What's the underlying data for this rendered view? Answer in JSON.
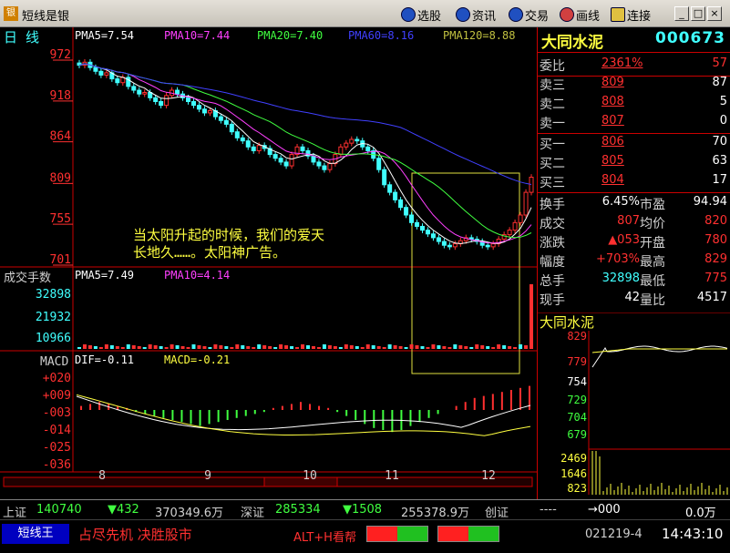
{
  "app": {
    "title": "短线是银",
    "menu": [
      "选股",
      "资讯",
      "交易",
      "画线",
      "连接"
    ]
  },
  "window_controls": [
    "_",
    "□",
    "×"
  ],
  "colors": {
    "up": "#ff3030",
    "down": "#40ffff",
    "pma5": "#ffffff",
    "pma10": "#ff40ff",
    "pma20": "#40ff40",
    "pma60": "#4040ff",
    "pma120": "#c0c040"
  },
  "kline": {
    "period_label": "日 线",
    "ma_labels": [
      {
        "text": "PMA5=7.54",
        "color": "#ffffff"
      },
      {
        "text": "PMA10=7.44",
        "color": "#ff40ff"
      },
      {
        "text": "PMA20=7.40",
        "color": "#40ff40"
      },
      {
        "text": "PMA60=8.16",
        "color": "#4040ff"
      },
      {
        "text": "PMA120=8.88",
        "color": "#c0c040"
      }
    ],
    "y_ticks": [
      "972",
      "918",
      "864",
      "809",
      "755",
      "701"
    ],
    "annotation_line1": "当太阳升起的时候，我们的爱天",
    "annotation_line2": "长地久……。太阳神广告。",
    "x_ticks": [
      "8",
      "9",
      "10",
      "11",
      "12"
    ]
  },
  "volume": {
    "title": "成交手数",
    "ma_labels": [
      {
        "text": "PMA5=7.49",
        "color": "#ffffff"
      },
      {
        "text": "PMA10=4.14",
        "color": "#ff40ff"
      }
    ],
    "y_ticks": [
      "32898",
      "21932",
      "10966"
    ]
  },
  "macd": {
    "title": "MACD",
    "labels": [
      {
        "text": "DIF=-0.11",
        "color": "#ffffff"
      },
      {
        "text": "MACD=-0.21",
        "color": "#ffff40"
      }
    ],
    "y_ticks": [
      "+020",
      "+009",
      "-003",
      "-014",
      "-025",
      "-036"
    ]
  },
  "quote": {
    "name": "大同水泥",
    "code": "000673",
    "rows": [
      {
        "label": "委比",
        "val": "2361%",
        "val_color": "#ff3030",
        "extra": "57",
        "extra_color": "#ff3030"
      },
      {
        "label": "卖三",
        "val": "809",
        "val_color": "#ff3030",
        "extra": "87",
        "extra_color": "#ffffff"
      },
      {
        "label": "卖二",
        "val": "808",
        "val_color": "#ff3030",
        "extra": "5",
        "extra_color": "#ffffff"
      },
      {
        "label": "卖一",
        "val": "807",
        "val_color": "#ff3030",
        "extra": "0",
        "extra_color": "#ffffff"
      },
      {
        "label": "买一",
        "val": "806",
        "val_color": "#ff3030",
        "extra": "70",
        "extra_color": "#ffffff"
      },
      {
        "label": "买二",
        "val": "805",
        "val_color": "#ff3030",
        "extra": "63",
        "extra_color": "#ffffff"
      },
      {
        "label": "买三",
        "val": "804",
        "val_color": "#ff3030",
        "extra": "17",
        "extra_color": "#ffffff"
      }
    ],
    "stats": [
      {
        "l1": "换手",
        "v1": "6.45%",
        "l2": "市盈",
        "v2": "94.94",
        "c1": "#ffffff",
        "c2": "#ffffff"
      },
      {
        "l1": "成交",
        "v1": "807",
        "l2": "均价",
        "v2": "820",
        "c1": "#ff3030",
        "c2": "#ff3030"
      },
      {
        "l1": "涨跌",
        "v1": "▲053",
        "l2": "开盘",
        "v2": "780",
        "c1": "#ff3030",
        "c2": "#ff3030"
      },
      {
        "l1": "幅度",
        "v1": "+703%",
        "l2": "最高",
        "v2": "829",
        "c1": "#ff3030",
        "c2": "#ff3030"
      },
      {
        "l1": "总手",
        "v1": "32898",
        "l2": "最低",
        "v2": "775",
        "c1": "#40ffff",
        "c2": "#ff3030"
      },
      {
        "l1": "现手",
        "v1": "42",
        "l2": "量比",
        "v2": "4517",
        "c1": "#ffffff",
        "c2": "#ffffff"
      }
    ]
  },
  "intraday": {
    "title": "大同水泥",
    "price_ticks": [
      "829",
      "779",
      "754",
      "729",
      "704",
      "679"
    ],
    "vol_ticks": [
      "2469",
      "1646",
      "823"
    ]
  },
  "status": {
    "sh_label": "上证",
    "sh_val": "140740",
    "sh_chg": "▼432",
    "sh_amt": "370349.6万",
    "sz_label": "深证",
    "sz_val": "285334",
    "sz_chg": "▼1508",
    "sz_amt": "255378.9万",
    "cy_label": "创证",
    "cy_dash": "----",
    "cy_arrow": "→000",
    "cy_amt": "0.0万"
  },
  "bottom": {
    "left_btn": "短线王",
    "slogan": "占尽先机 决胜股市",
    "hotkey": "ALT+H看帮",
    "date": "021219-4",
    "time": "14:43:10"
  },
  "chart_data": {
    "type": "candlestick",
    "title": "日线",
    "ylim": [
      701,
      972
    ],
    "x_tick_labels": [
      "8",
      "9",
      "10",
      "11",
      "12"
    ],
    "ma_values": {
      "PMA5": 7.54,
      "PMA10": 7.44,
      "PMA20": 7.4,
      "PMA60": 8.16,
      "PMA120": 8.88
    },
    "closes": [
      958,
      962,
      955,
      950,
      945,
      948,
      940,
      935,
      942,
      930,
      925,
      920,
      922,
      915,
      910,
      905,
      918,
      925,
      920,
      915,
      910,
      905,
      900,
      895,
      898,
      890,
      885,
      880,
      870,
      862,
      858,
      850,
      845,
      852,
      848,
      840,
      835,
      830,
      825,
      840,
      850,
      845,
      838,
      830,
      825,
      820,
      828,
      840,
      850,
      855,
      860,
      858,
      850,
      845,
      835,
      820,
      800,
      790,
      780,
      770,
      760,
      750,
      745,
      740,
      735,
      730,
      725,
      720,
      718,
      722,
      726,
      730,
      728,
      725,
      720,
      718,
      722,
      728,
      734,
      740,
      750,
      760,
      790,
      810
    ],
    "macd_hist": [
      2,
      3,
      4,
      3,
      2,
      1,
      -1,
      -2,
      -3,
      -4,
      -5,
      -6,
      -7,
      -8,
      -7,
      -6,
      -5,
      -4,
      -3,
      -2,
      -1,
      1,
      2,
      3,
      4,
      3,
      2,
      1,
      -1,
      -3,
      -5,
      -7,
      -9,
      -10,
      -11,
      -10,
      -8,
      -6,
      -4,
      -2,
      0,
      2,
      4,
      6,
      7,
      8,
      9,
      10,
      11,
      12
    ]
  }
}
